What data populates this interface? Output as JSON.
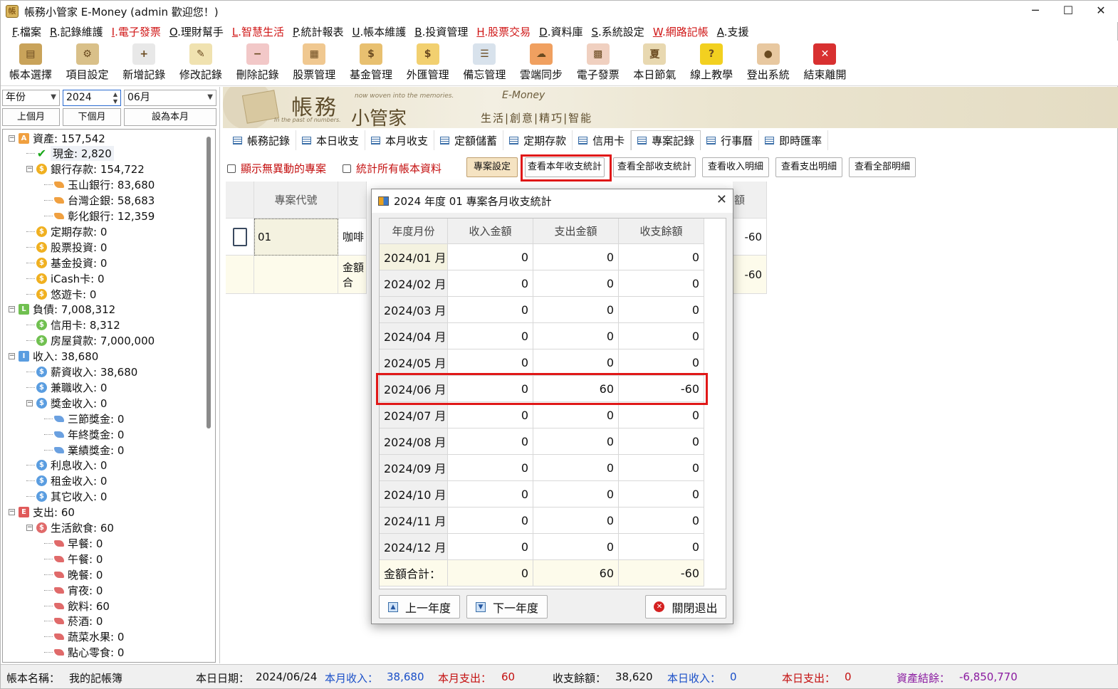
{
  "window": {
    "title": "帳務小管家 E-Money (admin 歡迎您！)",
    "min": "─",
    "max": "☐",
    "close": "✕"
  },
  "menu": [
    {
      "key": "F",
      "label": ".檔案",
      "red": false
    },
    {
      "key": "R",
      "label": ".記錄維護",
      "red": false
    },
    {
      "key": "I",
      "label": ".電子發票",
      "red": true
    },
    {
      "key": "O",
      "label": ".理財幫手",
      "red": false
    },
    {
      "key": "L",
      "label": ".智慧生活",
      "red": true
    },
    {
      "key": "P",
      "label": ".統計報表",
      "red": false
    },
    {
      "key": "U",
      "label": ".帳本維護",
      "red": false
    },
    {
      "key": "B",
      "label": ".投資管理",
      "red": false
    },
    {
      "key": "H",
      "label": ".股票交易",
      "red": true
    },
    {
      "key": "D",
      "label": ".資料庫",
      "red": false
    },
    {
      "key": "S",
      "label": ".系統設定",
      "red": false
    },
    {
      "key": "W",
      "label": ".網路記帳",
      "red": true
    },
    {
      "key": "A",
      "label": ".支援",
      "red": false
    }
  ],
  "toolbar": [
    {
      "label": "帳本選擇",
      "icon": "ledger-icon",
      "glyph": "▤",
      "color": "#c9a35a"
    },
    {
      "label": "項目設定",
      "icon": "settings-icon",
      "glyph": "⚙",
      "color": "#d9c089"
    },
    {
      "label": "新增記錄",
      "icon": "add-record-icon",
      "glyph": "+",
      "color": "#e8e8e8"
    },
    {
      "label": "修改記錄",
      "icon": "edit-record-icon",
      "glyph": "✎",
      "color": "#f0e2b0"
    },
    {
      "label": "刪除記錄",
      "icon": "delete-record-icon",
      "glyph": "−",
      "color": "#f2c8c8"
    },
    {
      "label": "股票管理",
      "icon": "stock-icon",
      "glyph": "▦",
      "color": "#f0c890"
    },
    {
      "label": "基金管理",
      "icon": "fund-icon",
      "glyph": "$",
      "color": "#e8c070"
    },
    {
      "label": "外匯管理",
      "icon": "forex-icon",
      "glyph": "$",
      "color": "#f2d070"
    },
    {
      "label": "備忘管理",
      "icon": "memo-icon",
      "glyph": "☰",
      "color": "#d8e2ec"
    },
    {
      "label": "雲端同步",
      "icon": "cloud-sync-icon",
      "glyph": "☁",
      "color": "#f0a060"
    },
    {
      "label": "電子發票",
      "icon": "qr-code-icon",
      "glyph": "▩",
      "color": "#f0d0c0"
    },
    {
      "label": "本日節氣",
      "icon": "solar-term-icon",
      "glyph": "夏",
      "color": "#e8d8b0"
    },
    {
      "label": "線上教學",
      "icon": "help-icon",
      "glyph": "?",
      "color": "#f2d020"
    },
    {
      "label": "登出系統",
      "icon": "logout-icon",
      "glyph": "●",
      "color": "#e8c8a0"
    },
    {
      "label": "結束離開",
      "icon": "exit-icon",
      "glyph": "✕",
      "color": "#d83030"
    }
  ],
  "left": {
    "period_select": "年份",
    "year_value": "2024",
    "month_select": "06月",
    "prev_month": "上個月",
    "next_month": "下個月",
    "set_this_month": "設為本月"
  },
  "tree": [
    {
      "indent": 0,
      "box": "−",
      "icon": "A",
      "icolor": "#f0a040",
      "shape": "sq",
      "label": "資產: 157,542"
    },
    {
      "indent": 1,
      "box": "",
      "icon": "✔",
      "icolor": "",
      "shape": "check",
      "label": "現金: 2,820",
      "sel": true
    },
    {
      "indent": 1,
      "box": "−",
      "icon": "$",
      "icolor": "#f0b020",
      "shape": "c",
      "label": "銀行存款: 154,722"
    },
    {
      "indent": 2,
      "box": "",
      "icon": "",
      "icolor": "#f0a040",
      "shape": "leaf",
      "label": "玉山銀行: 83,680"
    },
    {
      "indent": 2,
      "box": "",
      "icon": "",
      "icolor": "#f0a040",
      "shape": "leaf",
      "label": "台灣企銀: 58,683"
    },
    {
      "indent": 2,
      "box": "",
      "icon": "",
      "icolor": "#f0a040",
      "shape": "leaf",
      "label": "彰化銀行: 12,359"
    },
    {
      "indent": 1,
      "box": "",
      "icon": "$",
      "icolor": "#f0b020",
      "shape": "c",
      "label": "定期存款: 0"
    },
    {
      "indent": 1,
      "box": "",
      "icon": "$",
      "icolor": "#f0b020",
      "shape": "c",
      "label": "股票投資: 0"
    },
    {
      "indent": 1,
      "box": "",
      "icon": "$",
      "icolor": "#f0b020",
      "shape": "c",
      "label": "基金投資: 0"
    },
    {
      "indent": 1,
      "box": "",
      "icon": "$",
      "icolor": "#f0b020",
      "shape": "c",
      "label": "iCash卡: 0"
    },
    {
      "indent": 1,
      "box": "",
      "icon": "$",
      "icolor": "#f0b020",
      "shape": "c",
      "label": "悠遊卡: 0"
    },
    {
      "indent": 0,
      "box": "−",
      "icon": "L",
      "icolor": "#70c050",
      "shape": "sq",
      "label": "負債: 7,008,312"
    },
    {
      "indent": 1,
      "box": "",
      "icon": "$",
      "icolor": "#70c050",
      "shape": "c",
      "label": "信用卡: 8,312"
    },
    {
      "indent": 1,
      "box": "",
      "icon": "$",
      "icolor": "#70c050",
      "shape": "c",
      "label": "房屋貸款: 7,000,000"
    },
    {
      "indent": 0,
      "box": "−",
      "icon": "I",
      "icolor": "#5a9de0",
      "shape": "sq",
      "label": "收入: 38,680"
    },
    {
      "indent": 1,
      "box": "",
      "icon": "$",
      "icolor": "#5a9de0",
      "shape": "c",
      "label": "薪資收入: 38,680"
    },
    {
      "indent": 1,
      "box": "",
      "icon": "$",
      "icolor": "#5a9de0",
      "shape": "c",
      "label": "兼職收入: 0"
    },
    {
      "indent": 1,
      "box": "−",
      "icon": "$",
      "icolor": "#5a9de0",
      "shape": "c",
      "label": "獎金收入: 0"
    },
    {
      "indent": 2,
      "box": "",
      "icon": "",
      "icolor": "#6aa0e0",
      "shape": "leaf",
      "label": "三節獎金: 0"
    },
    {
      "indent": 2,
      "box": "",
      "icon": "",
      "icolor": "#6aa0e0",
      "shape": "leaf",
      "label": "年終獎金: 0"
    },
    {
      "indent": 2,
      "box": "",
      "icon": "",
      "icolor": "#6aa0e0",
      "shape": "leaf",
      "label": "業績獎金: 0"
    },
    {
      "indent": 1,
      "box": "",
      "icon": "$",
      "icolor": "#5a9de0",
      "shape": "c",
      "label": "利息收入: 0"
    },
    {
      "indent": 1,
      "box": "",
      "icon": "$",
      "icolor": "#5a9de0",
      "shape": "c",
      "label": "租金收入: 0"
    },
    {
      "indent": 1,
      "box": "",
      "icon": "$",
      "icolor": "#5a9de0",
      "shape": "c",
      "label": "其它收入: 0"
    },
    {
      "indent": 0,
      "box": "−",
      "icon": "E",
      "icolor": "#e05a5a",
      "shape": "sq",
      "label": "支出: 60"
    },
    {
      "indent": 1,
      "box": "−",
      "icon": "$",
      "icolor": "#e06a6a",
      "shape": "c",
      "label": "生活飲食: 60"
    },
    {
      "indent": 2,
      "box": "",
      "icon": "",
      "icolor": "#e06a6a",
      "shape": "leaf",
      "label": "早餐: 0"
    },
    {
      "indent": 2,
      "box": "",
      "icon": "",
      "icolor": "#e06a6a",
      "shape": "leaf",
      "label": "午餐: 0"
    },
    {
      "indent": 2,
      "box": "",
      "icon": "",
      "icolor": "#e06a6a",
      "shape": "leaf",
      "label": "晚餐: 0"
    },
    {
      "indent": 2,
      "box": "",
      "icon": "",
      "icolor": "#e06a6a",
      "shape": "leaf",
      "label": "宵夜: 0"
    },
    {
      "indent": 2,
      "box": "",
      "icon": "",
      "icolor": "#e06a6a",
      "shape": "leaf",
      "label": "飲料: 60"
    },
    {
      "indent": 2,
      "box": "",
      "icon": "",
      "icolor": "#e06a6a",
      "shape": "leaf",
      "label": "菸酒: 0"
    },
    {
      "indent": 2,
      "box": "",
      "icon": "",
      "icolor": "#e06a6a",
      "shape": "leaf",
      "label": "蔬菜水果: 0"
    },
    {
      "indent": 2,
      "box": "",
      "icon": "",
      "icolor": "#e06a6a",
      "shape": "leaf",
      "label": "點心零食: 0"
    }
  ],
  "banner": {
    "t1": "帳務",
    "t2": "小管家",
    "t3": "now woven into the memories.",
    "t4": "In the past of numbers.",
    "t5": "E-Money",
    "t6": "生活|創意|精巧|智能"
  },
  "tabs": [
    "帳務記錄",
    "本日收支",
    "本月收支",
    "定額儲蓄",
    "定期存款",
    "信用卡",
    "專案記錄",
    "行事曆",
    "即時匯率"
  ],
  "active_tab": "專案記錄",
  "options": {
    "show_no_change": "顯示無異動的專案",
    "stat_all_books": "統計所有帳本資料",
    "project_settings": "專案設定",
    "view_year": "查看本年收支統計",
    "view_all": "查看全部收支統計",
    "view_income": "查看收入明細",
    "view_expense": "查看支出明細",
    "view_all_detail": "查看全部明細"
  },
  "bg_grid": {
    "h_code": "專案代號",
    "h_amount": "額",
    "code": "01",
    "name": "咖啡",
    "amount": "-60",
    "total_label": "金額合",
    "total_amount": "-60"
  },
  "dialog": {
    "title": "2024 年度 01 專案各月收支統計",
    "headers": [
      "年度月份",
      "收入金額",
      "支出金額",
      "收支餘額"
    ],
    "rows": [
      [
        "2024/01 月",
        "0",
        "0",
        "0"
      ],
      [
        "2024/02 月",
        "0",
        "0",
        "0"
      ],
      [
        "2024/03 月",
        "0",
        "0",
        "0"
      ],
      [
        "2024/04 月",
        "0",
        "0",
        "0"
      ],
      [
        "2024/05 月",
        "0",
        "0",
        "0"
      ],
      [
        "2024/06 月",
        "0",
        "60",
        "-60"
      ],
      [
        "2024/07 月",
        "0",
        "0",
        "0"
      ],
      [
        "2024/08 月",
        "0",
        "0",
        "0"
      ],
      [
        "2024/09 月",
        "0",
        "0",
        "0"
      ],
      [
        "2024/10 月",
        "0",
        "0",
        "0"
      ],
      [
        "2024/11 月",
        "0",
        "0",
        "0"
      ],
      [
        "2024/12 月",
        "0",
        "0",
        "0"
      ]
    ],
    "total": [
      "金額合計：",
      "0",
      "60",
      "-60"
    ],
    "prev_year": "上一年度",
    "next_year": "下一年度",
    "close": "關閉退出"
  },
  "status": {
    "book_label": "帳本名稱：",
    "book_value": "我的記帳簿",
    "date_label": "本日日期：",
    "date_value": "2024/06/24",
    "month_income_label": "本月收入：",
    "month_income_value": "38,680",
    "month_expense_label": "本月支出：",
    "month_expense_value": "60",
    "balance_label": "收支餘額：",
    "balance_value": "38,620",
    "day_income_label": "本日收入：",
    "day_income_value": "0",
    "day_expense_label": "本日支出：",
    "day_expense_value": "0",
    "asset_label": "資產結餘：",
    "asset_value": "-6,850,770"
  },
  "colors": {
    "highlight": "#e01818",
    "blue": "#1a4fc8",
    "red": "#c41010",
    "purple": "#8a1aa0"
  }
}
